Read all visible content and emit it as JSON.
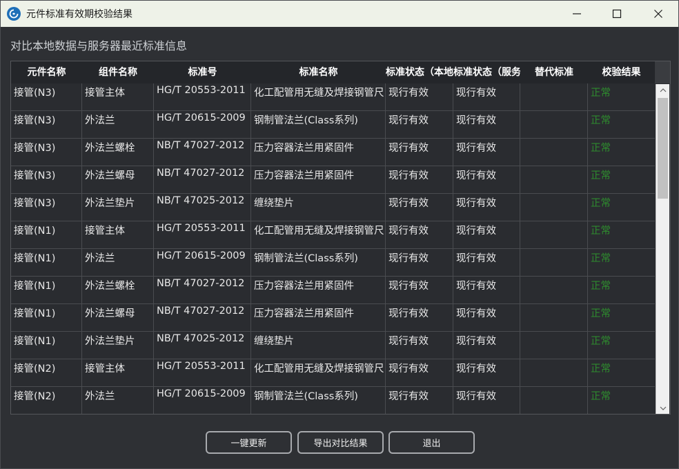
{
  "window": {
    "title": "元件标准有效期校验结果",
    "subtitle": "对比本地数据与服务器最近标准信息"
  },
  "table": {
    "headers": [
      "元件名称",
      "组件名称",
      "标准号",
      "标准名称",
      "标准状态（本地",
      "标准状态（服务",
      "替代标准",
      "校验结果"
    ],
    "rows": [
      [
        "接管(N3)",
        "接管主体",
        "HG/T 20553-2011",
        "化工配管用无缝及焊接钢管尺",
        "现行有效",
        "现行有效",
        "",
        "正常"
      ],
      [
        "接管(N3)",
        "外法兰",
        "HG/T 20615-2009",
        "钢制管法兰(Class系列)",
        "现行有效",
        "现行有效",
        "",
        "正常"
      ],
      [
        "接管(N3)",
        "外法兰螺栓",
        "NB/T 47027-2012",
        "压力容器法兰用紧固件",
        "现行有效",
        "现行有效",
        "",
        "正常"
      ],
      [
        "接管(N3)",
        "外法兰螺母",
        "NB/T 47027-2012",
        "压力容器法兰用紧固件",
        "现行有效",
        "现行有效",
        "",
        "正常"
      ],
      [
        "接管(N3)",
        "外法兰垫片",
        "NB/T 47025-2012",
        "缠绕垫片",
        "现行有效",
        "现行有效",
        "",
        "正常"
      ],
      [
        "接管(N1)",
        "接管主体",
        "HG/T 20553-2011",
        "化工配管用无缝及焊接钢管尺",
        "现行有效",
        "现行有效",
        "",
        "正常"
      ],
      [
        "接管(N1)",
        "外法兰",
        "HG/T 20615-2009",
        "钢制管法兰(Class系列)",
        "现行有效",
        "现行有效",
        "",
        "正常"
      ],
      [
        "接管(N1)",
        "外法兰螺栓",
        "NB/T 47027-2012",
        "压力容器法兰用紧固件",
        "现行有效",
        "现行有效",
        "",
        "正常"
      ],
      [
        "接管(N1)",
        "外法兰螺母",
        "NB/T 47027-2012",
        "压力容器法兰用紧固件",
        "现行有效",
        "现行有效",
        "",
        "正常"
      ],
      [
        "接管(N1)",
        "外法兰垫片",
        "NB/T 47025-2012",
        "缠绕垫片",
        "现行有效",
        "现行有效",
        "",
        "正常"
      ],
      [
        "接管(N2)",
        "接管主体",
        "HG/T 20553-2011",
        "化工配管用无缝及焊接钢管尺",
        "现行有效",
        "现行有效",
        "",
        "正常"
      ],
      [
        "接管(N2)",
        "外法兰",
        "HG/T 20615-2009",
        "钢制管法兰(Class系列)",
        "现行有效",
        "现行有效",
        "",
        "正常"
      ]
    ]
  },
  "buttons": {
    "update": "一键更新",
    "export": "导出对比结果",
    "exit": "退出"
  },
  "colors": {
    "ok": "#2e8b2e",
    "titlebar": "#eef2e8",
    "background": "#2e3034"
  },
  "icons": {
    "app": "app-logo-icon",
    "minimize": "minimize-icon",
    "maximize": "maximize-icon",
    "close": "close-icon",
    "scroll_up": "chevron-up-icon",
    "scroll_down": "chevron-down-icon"
  }
}
